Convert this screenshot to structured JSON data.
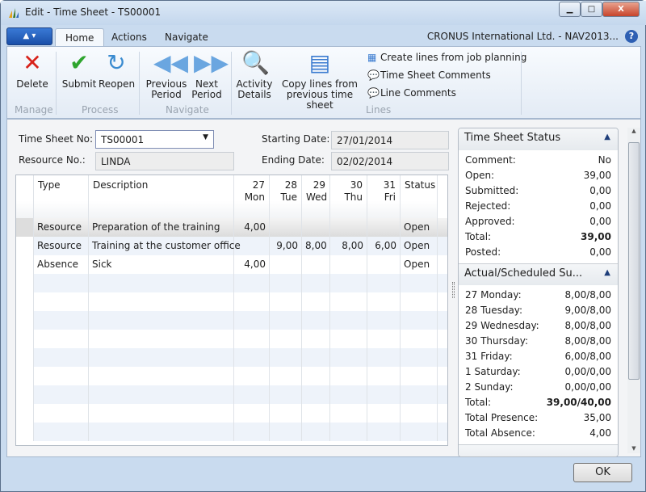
{
  "window": {
    "title": "Edit - Time Sheet - TS00001",
    "minimize": "▁",
    "maximize": "□",
    "close": "X"
  },
  "ribbon": {
    "tabs": [
      "Home",
      "Actions",
      "Navigate"
    ],
    "company": "CRONUS International Ltd. - NAV2013...",
    "help": "?",
    "groups": {
      "manage": "Manage",
      "process": "Process",
      "navigate": "Navigate",
      "lines": "Lines"
    },
    "buttons": {
      "delete": "Delete",
      "submit": "Submit",
      "reopen": "Reopen",
      "prev1": "Previous",
      "prev2": "Period",
      "next1": "Next",
      "next2": "Period",
      "activity1": "Activity",
      "activity2": "Details",
      "copy1": "Copy lines from",
      "copy2": "previous time sheet"
    },
    "small": {
      "create": "Create lines from job planning",
      "tscomments": "Time Sheet Comments",
      "linecomments": "Line Comments"
    }
  },
  "header": {
    "time_sheet_no_label": "Time Sheet No:",
    "time_sheet_no": "TS00001",
    "resource_no_label": "Resource No.:",
    "resource_no": "LINDA",
    "starting_date_label": "Starting Date:",
    "starting_date": "27/01/2014",
    "ending_date_label": "Ending Date:",
    "ending_date": "02/02/2014"
  },
  "grid": {
    "columns": [
      {
        "a": "Type",
        "b": ""
      },
      {
        "a": "Description",
        "b": ""
      },
      {
        "a": "27",
        "b": "Mon"
      },
      {
        "a": "28",
        "b": "Tue"
      },
      {
        "a": "29",
        "b": "Wed"
      },
      {
        "a": "30",
        "b": "Thu"
      },
      {
        "a": "31 Fri",
        "b": ""
      },
      {
        "a": "Status",
        "b": ""
      }
    ],
    "rows": [
      [
        "Resource",
        "Preparation of the training",
        "4,00",
        "",
        "",
        "",
        "",
        "Open"
      ],
      [
        "Resource",
        "Training at the customer office",
        "",
        "9,00",
        "8,00",
        "8,00",
        "6,00",
        "Open"
      ],
      [
        "Absence",
        "Sick",
        "4,00",
        "",
        "",
        "",
        "",
        "Open"
      ]
    ]
  },
  "factbox": {
    "status": {
      "title": "Time Sheet Status",
      "rows": [
        [
          "Comment:",
          "No"
        ],
        [
          "Open:",
          "39,00"
        ],
        [
          "Submitted:",
          "0,00"
        ],
        [
          "Rejected:",
          "0,00"
        ],
        [
          "Approved:",
          "0,00"
        ],
        [
          "Total:",
          "39,00"
        ],
        [
          "Posted:",
          "0,00"
        ]
      ]
    },
    "actual": {
      "title": "Actual/Scheduled Su...",
      "rows": [
        [
          "27 Monday:",
          "8,00/8,00"
        ],
        [
          "28 Tuesday:",
          "9,00/8,00"
        ],
        [
          "29 Wednesday:",
          "8,00/8,00"
        ],
        [
          "30 Thursday:",
          "8,00/8,00"
        ],
        [
          "31 Friday:",
          "6,00/8,00"
        ],
        [
          "1 Saturday:",
          "0,00/0,00"
        ],
        [
          "2 Sunday:",
          "0,00/0,00"
        ],
        [
          "Total:",
          "39,00/40,00"
        ],
        [
          "Total Presence:",
          "35,00"
        ],
        [
          "Total Absence:",
          "4,00"
        ]
      ]
    }
  },
  "footer": {
    "ok": "OK"
  }
}
